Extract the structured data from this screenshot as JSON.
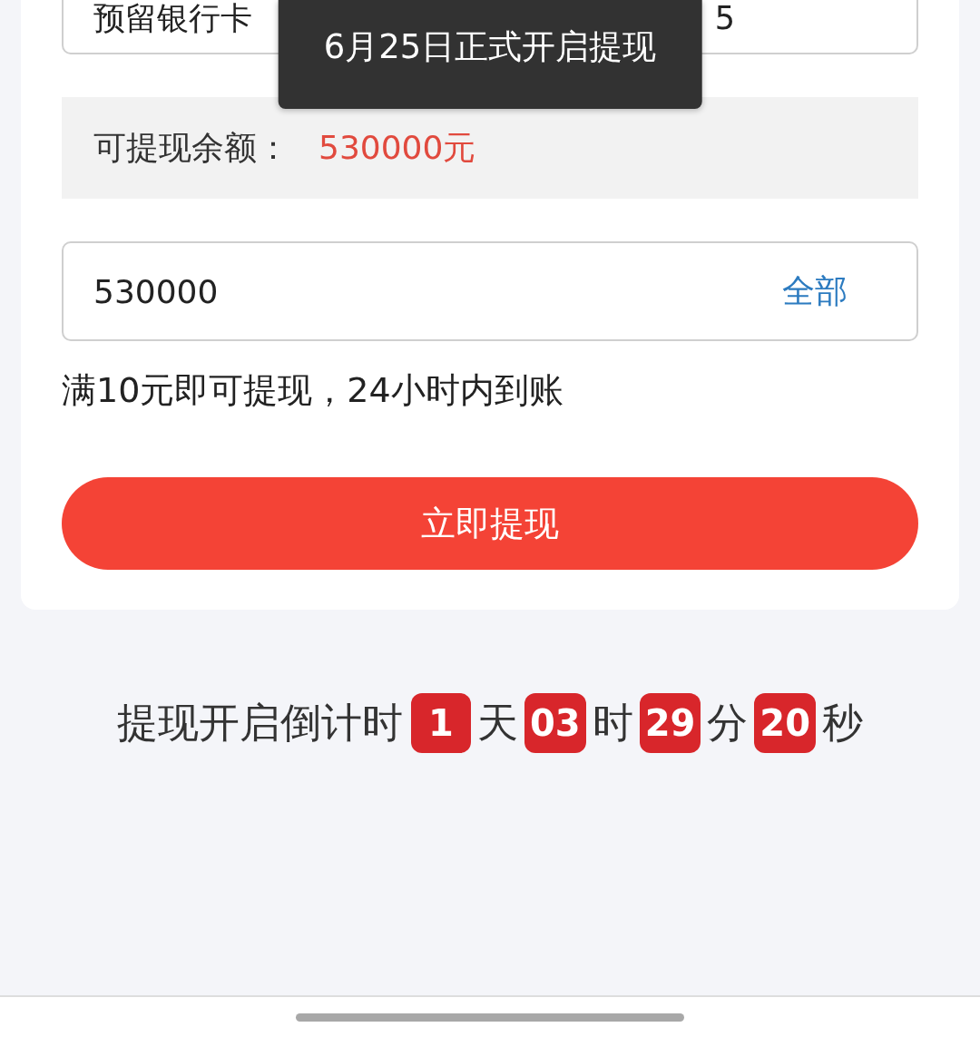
{
  "bank_card_field": {
    "label": "预留银行卡",
    "value": "5"
  },
  "toast": {
    "text": "6月25日正式开启提现"
  },
  "balance": {
    "label": "可提现余额：",
    "amount": "530000元"
  },
  "amount_field": {
    "value": "530000",
    "all_button": "全部"
  },
  "hint": "满10元即可提现，24小时内到账",
  "withdraw_button": "立即提现",
  "countdown": {
    "label": "提现开启倒计时",
    "parts": [
      {
        "value": "1",
        "unit": "天"
      },
      {
        "value": "03",
        "unit": "时"
      },
      {
        "value": "29",
        "unit": "分"
      },
      {
        "value": "20",
        "unit": "秒"
      }
    ]
  }
}
